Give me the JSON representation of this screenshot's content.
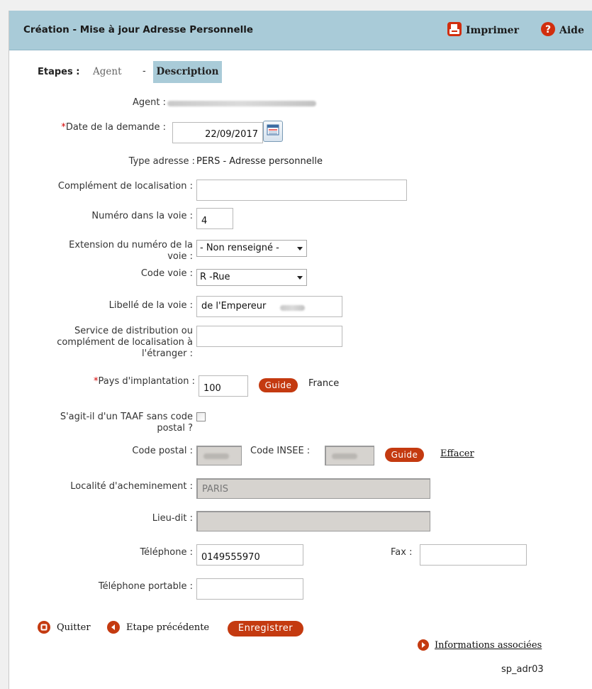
{
  "header": {
    "title": "Création - Mise à jour Adresse Personnelle",
    "print_label": "Imprimer",
    "help_label": "Aide",
    "bg_color": "#a9cbd8"
  },
  "steps": {
    "label": "Etapes :",
    "agent": "Agent",
    "separator": "-",
    "description": "Description"
  },
  "form": {
    "agent_label": "Agent :",
    "date_label": "Date de la demande :",
    "date_value": "22/09/2017",
    "type_label": "Type adresse :",
    "type_value": "PERS - Adresse personnelle",
    "complement_label": "Complément de localisation :",
    "complement_value": "",
    "numero_label": "Numéro dans la voie :",
    "numero_value": "4",
    "extension_label_1": "Extension du numéro de la",
    "extension_label_2": "voie :",
    "extension_value": "- Non renseigné -",
    "code_voie_label": "Code voie :",
    "code_voie_value": "R -Rue",
    "libelle_label": "Libellé de la voie :",
    "libelle_value": "de l'Empereur",
    "service_label_1": "Service de distribution ou",
    "service_label_2": "complément de localisation à",
    "service_label_3": "l'étranger :",
    "service_value": "",
    "pays_label": "Pays d'implantation :",
    "pays_value": "100",
    "guide_label": "Guide",
    "pays_name": "France",
    "taaf_label_1": "S'agit-il d'un TAAF sans code",
    "taaf_label_2": "postal ?",
    "code_postal_label": "Code postal :",
    "code_insee_label": "Code INSEE :",
    "effacer_label": "Effacer",
    "localite_label": "Localité d'acheminement :",
    "localite_value": "PARIS",
    "lieu_dit_label": "Lieu-dit :",
    "lieu_dit_value": "",
    "telephone_label": "Téléphone :",
    "telephone_value": "0149555970",
    "fax_label": "Fax :",
    "fax_value": "",
    "portable_label": "Téléphone portable :",
    "portable_value": ""
  },
  "footer": {
    "quit_label": "Quitter",
    "prev_label": "Etape précédente",
    "save_label": "Enregistrer",
    "related_label": "Informations associées",
    "screen_id": "sp_adr03"
  },
  "colors": {
    "accent": "#c43a10",
    "required": "#d40000"
  }
}
